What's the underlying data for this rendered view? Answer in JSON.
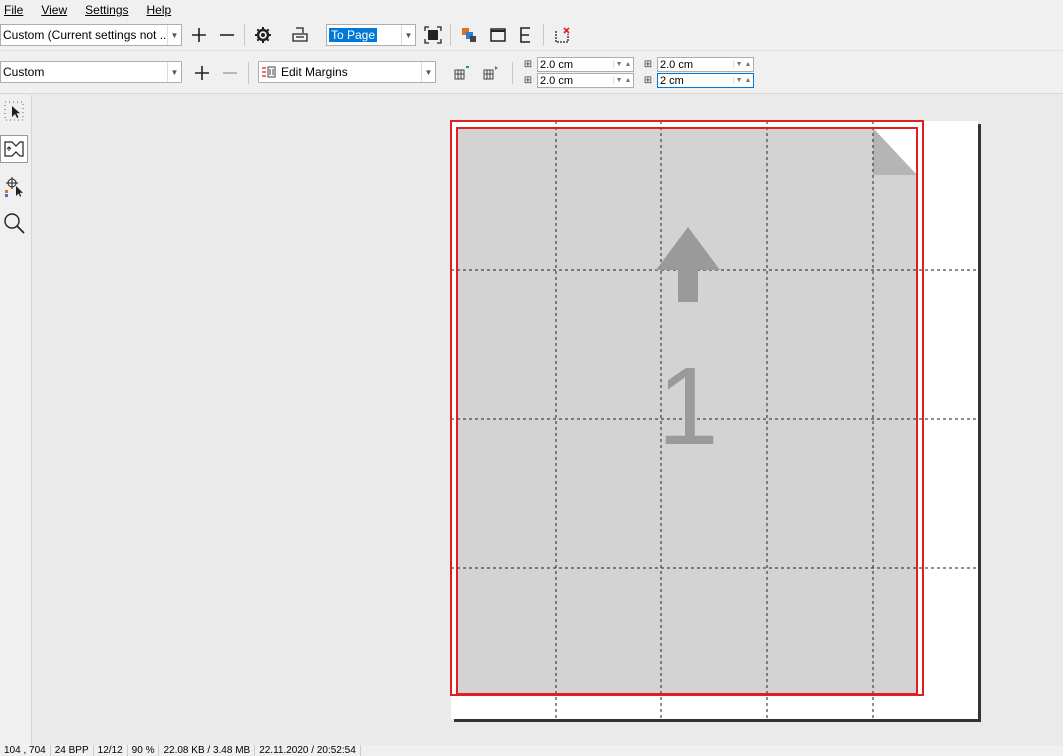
{
  "menu": [
    "File",
    "View",
    "Settings",
    "Help"
  ],
  "toolbar1": {
    "preset": "Custom (Current settings not ...",
    "zoom": "To Page"
  },
  "toolbar2": {
    "layout": "Custom",
    "margins_mode": "Edit Margins",
    "margin_top": "2.0 cm",
    "margin_bottom": "2.0 cm",
    "margin_left": "2.0 cm",
    "margin_right": "2 cm"
  },
  "page": {
    "number": "1"
  },
  "status": {
    "coords": "104 , 704",
    "bpp": "24 BPP",
    "pages": "12/12",
    "zoom": "90 %",
    "memory": "22.08 KB / 3.48 MB",
    "datetime": "22.11.2020 / 20:52:54"
  },
  "colors": {
    "margin_red": "#e02020",
    "page_gray": "#d3d3d3",
    "accent": "#0078d7"
  }
}
